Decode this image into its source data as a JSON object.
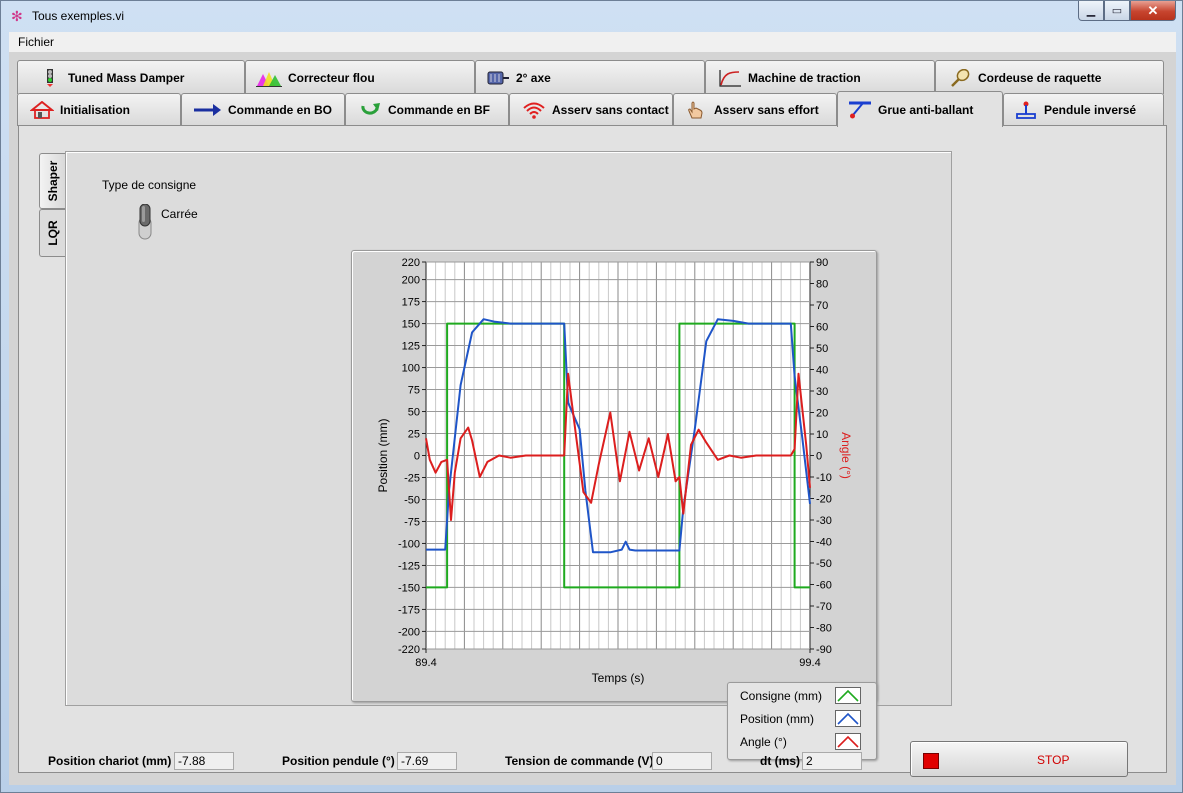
{
  "window": {
    "title": "Tous exemples.vi"
  },
  "menu": {
    "items": [
      "Fichier"
    ]
  },
  "tabs_row1": [
    {
      "label": "Tuned Mass Damper",
      "icon": "traffic-light-icon"
    },
    {
      "label": "Correcteur flou",
      "icon": "fuzzy-triangles-icon"
    },
    {
      "label": "2° axe",
      "icon": "motor-icon"
    },
    {
      "label": "Machine de traction",
      "icon": "curve-icon"
    },
    {
      "label": "Cordeuse de raquette",
      "icon": "racket-icon"
    }
  ],
  "tabs_row2": [
    {
      "label": "Initialisation",
      "icon": "home-icon"
    },
    {
      "label": "Commande en BO",
      "icon": "arrow-right-icon"
    },
    {
      "label": "Commande en BF",
      "icon": "loop-arrow-icon"
    },
    {
      "label": "Asserv sans contact",
      "icon": "wifi-icon"
    },
    {
      "label": "Asserv sans effort",
      "icon": "hand-icon"
    },
    {
      "label": "Grue anti-ballant",
      "icon": "crane-icon"
    },
    {
      "label": "Pendule inversé",
      "icon": "pendulum-icon"
    }
  ],
  "side_tabs": [
    "Shaper",
    "LQR"
  ],
  "consigne": {
    "label": "Type de consigne",
    "value": "Carrée"
  },
  "chart_data": {
    "type": "line",
    "xlabel": "Temps (s)",
    "ylabel": "Position (mm)",
    "ylabel_right": "Angle (°)",
    "xlim": [
      89.4,
      99.4
    ],
    "ylim": [
      -220,
      220
    ],
    "ylim_right": [
      -90,
      90
    ],
    "xticks": [
      "89.4",
      "99.4"
    ],
    "yticks": [
      220,
      200,
      175,
      150,
      125,
      100,
      75,
      50,
      25,
      0,
      -25,
      -50,
      -75,
      -100,
      -125,
      -150,
      -175,
      -200,
      -220
    ],
    "yticks_right": [
      90,
      80,
      70,
      60,
      50,
      40,
      30,
      20,
      10,
      0,
      -10,
      -20,
      -30,
      -40,
      -50,
      -60,
      -70,
      -80,
      -90
    ],
    "grid": true,
    "legend_position": "bottom-right",
    "series": [
      {
        "name": "Consigne (mm)",
        "axis": "left",
        "color": "#1faa1f",
        "x": [
          89.4,
          89.95,
          89.95,
          93.0,
          93.0,
          96.0,
          96.0,
          99.0,
          99.0,
          99.4
        ],
        "y": [
          -150,
          -150,
          150,
          150,
          -150,
          -150,
          150,
          150,
          -150,
          -150
        ]
      },
      {
        "name": "Position (mm)",
        "axis": "left",
        "color": "#1f55c8",
        "x": [
          89.4,
          89.9,
          90.0,
          90.3,
          90.6,
          90.9,
          91.2,
          91.6,
          92.0,
          92.5,
          93.0,
          93.1,
          93.4,
          93.55,
          93.75,
          94.2,
          94.5,
          94.6,
          94.7,
          94.85,
          95.2,
          95.7,
          96.0,
          96.1,
          96.4,
          96.7,
          97.0,
          97.4,
          97.8,
          98.3,
          98.7,
          98.9,
          99.0,
          99.2,
          99.4
        ],
        "y": [
          -107,
          -107,
          -40,
          80,
          140,
          155,
          152,
          150,
          150,
          150,
          150,
          60,
          30,
          -40,
          -110,
          -110,
          -107,
          -98,
          -107,
          -108,
          -108,
          -108,
          -108,
          -60,
          30,
          130,
          155,
          153,
          150,
          150,
          150,
          150,
          90,
          20,
          -55
        ]
      },
      {
        "name": "Angle (°)",
        "axis": "right",
        "color": "#dc1e1e",
        "x": [
          89.4,
          89.5,
          89.65,
          89.8,
          89.95,
          90.05,
          90.15,
          90.3,
          90.5,
          90.6,
          90.8,
          91.0,
          91.3,
          91.6,
          92.0,
          92.5,
          93.0,
          93.1,
          93.3,
          93.5,
          93.7,
          93.9,
          94.2,
          94.45,
          94.7,
          94.95,
          95.2,
          95.45,
          95.7,
          95.9,
          96.0,
          96.1,
          96.3,
          96.5,
          96.7,
          97.0,
          97.3,
          97.6,
          98.0,
          98.5,
          98.9,
          99.0,
          99.1,
          99.3,
          99.4
        ],
        "y": [
          8,
          -2,
          -8,
          -3,
          -2,
          -30,
          -8,
          8,
          13,
          7,
          -10,
          -3,
          0,
          -1,
          0,
          0,
          0,
          38,
          10,
          -17,
          -22,
          -4,
          20,
          -12,
          11,
          -7,
          8,
          -10,
          10,
          -12,
          -10,
          -27,
          5,
          12,
          6,
          -2,
          0,
          -1,
          0,
          0,
          0,
          3,
          38,
          5,
          -15
        ]
      }
    ]
  },
  "status": {
    "chariot_label": "Position chariot (mm)",
    "chariot_value": "-7.88",
    "pendule_label": "Position pendule (°)",
    "pendule_value": "-7.69",
    "tension_label": "Tension de commande (V)",
    "tension_value": "0",
    "dt_label": "dt (ms)",
    "dt_value": "2"
  },
  "stop": {
    "label": "STOP"
  }
}
